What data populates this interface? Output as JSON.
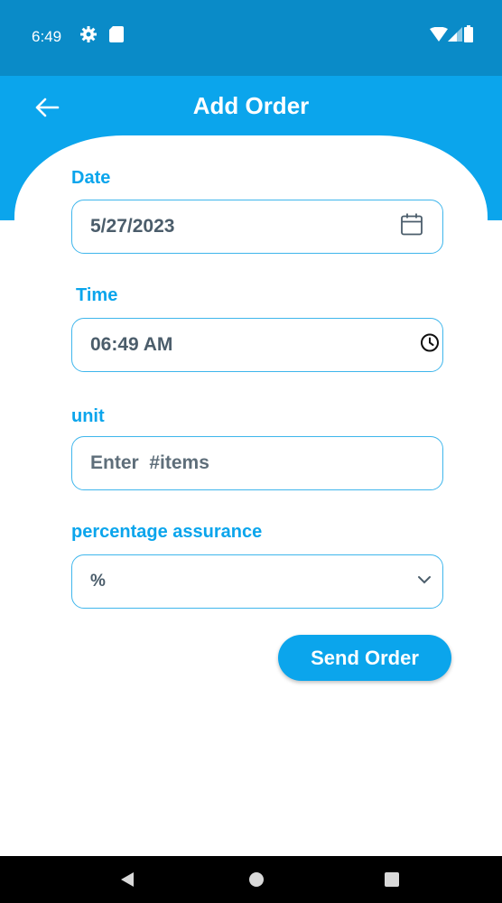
{
  "status_bar": {
    "time": "6:49",
    "icons": [
      "settings-gear-icon",
      "sd-card-icon",
      "wifi-icon",
      "signal-icon",
      "battery-icon"
    ]
  },
  "app_bar": {
    "title": "Add Order",
    "back_icon": "arrow-left-icon",
    "color": "#0ba5ec",
    "status_color": "#0a8bc8"
  },
  "form": {
    "date": {
      "label": "Date",
      "value": "5/27/2023",
      "icon": "calendar-icon"
    },
    "time": {
      "label": "Time",
      "value": "06:49 AM",
      "icon": "clock-icon"
    },
    "unit": {
      "label": "unit",
      "placeholder": "Enter  #items",
      "value": ""
    },
    "assurance": {
      "label": "percentage assurance",
      "selected": "%",
      "icon": "chevron-down-icon"
    }
  },
  "actions": {
    "send_label": "Send Order"
  },
  "nav_bar": {
    "items": [
      "back-triangle-icon",
      "home-circle-icon",
      "recents-square-icon"
    ]
  },
  "colors": {
    "accent": "#0ba5ec",
    "field_border": "#3fb6ec",
    "field_text": "#4b5d6b"
  }
}
